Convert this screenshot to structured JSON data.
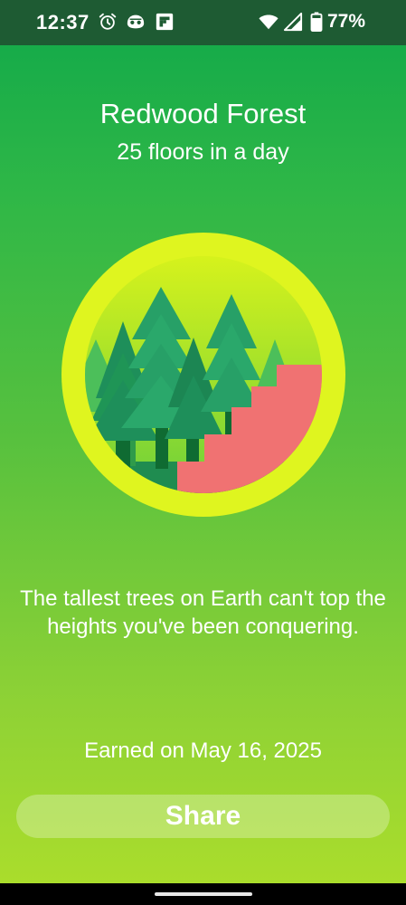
{
  "status_bar": {
    "time": "12:37",
    "battery_percent": "77%",
    "battery_level": 0.77,
    "icons": [
      "alarm-icon",
      "app-notification-icon",
      "flipboard-icon",
      "wifi-icon",
      "cellular-signal-icon",
      "battery-icon"
    ]
  },
  "achievement": {
    "title": "Redwood Forest",
    "subtitle": "25 floors in a day",
    "badge_icon": "redwood-forest-badge-icon",
    "description": "The tallest trees on Earth can't top the heights you've been conquering.",
    "earned": "Earned on May 16, 2025"
  },
  "share_button": {
    "label": "Share"
  },
  "colors": {
    "background_top": "#0fa84a",
    "background_bottom": "#aadd2c",
    "status_bar": "#1e5b33",
    "badge_ring": "#dff51f",
    "stairs": "#f07272",
    "tree_dark": "#1e8f5a",
    "tree_light": "#3fb85f"
  }
}
